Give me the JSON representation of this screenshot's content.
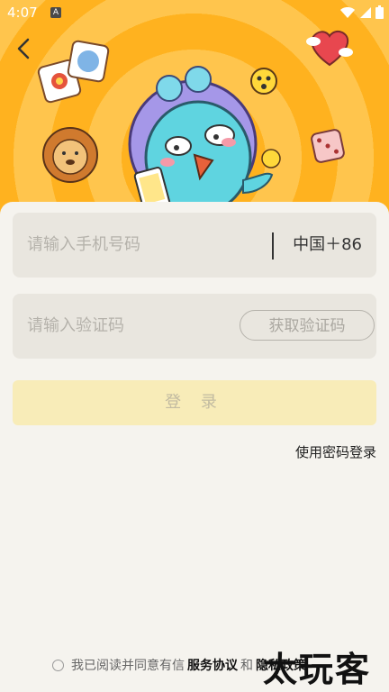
{
  "status_bar": {
    "time": "4:07",
    "app_badge": "A"
  },
  "form": {
    "phone_placeholder": "请输入手机号码",
    "country_code": "中国＋86",
    "code_placeholder": "请输入验证码",
    "get_code_label": "获取验证码",
    "login_label": "登 录",
    "password_login_label": "使用密码登录"
  },
  "agreement": {
    "prefix": "我已阅读并同意有信",
    "service_agreement": "服务协议",
    "conjunction": "和",
    "privacy_policy": "隐私政策"
  },
  "watermark": "太玩客",
  "colors": {
    "hero_orange": "#ffb21f",
    "login_button_bg": "#f8ecb8",
    "field_bg": "#e9e6df"
  },
  "icons": [
    "back-arrow-icon",
    "wifi-icon",
    "signal-icon",
    "battery-icon",
    "mascot-illustration",
    "flower-card-icon",
    "lion-icon",
    "heart-icon",
    "dice-icon",
    "smiley-icon",
    "radio-icon"
  ]
}
